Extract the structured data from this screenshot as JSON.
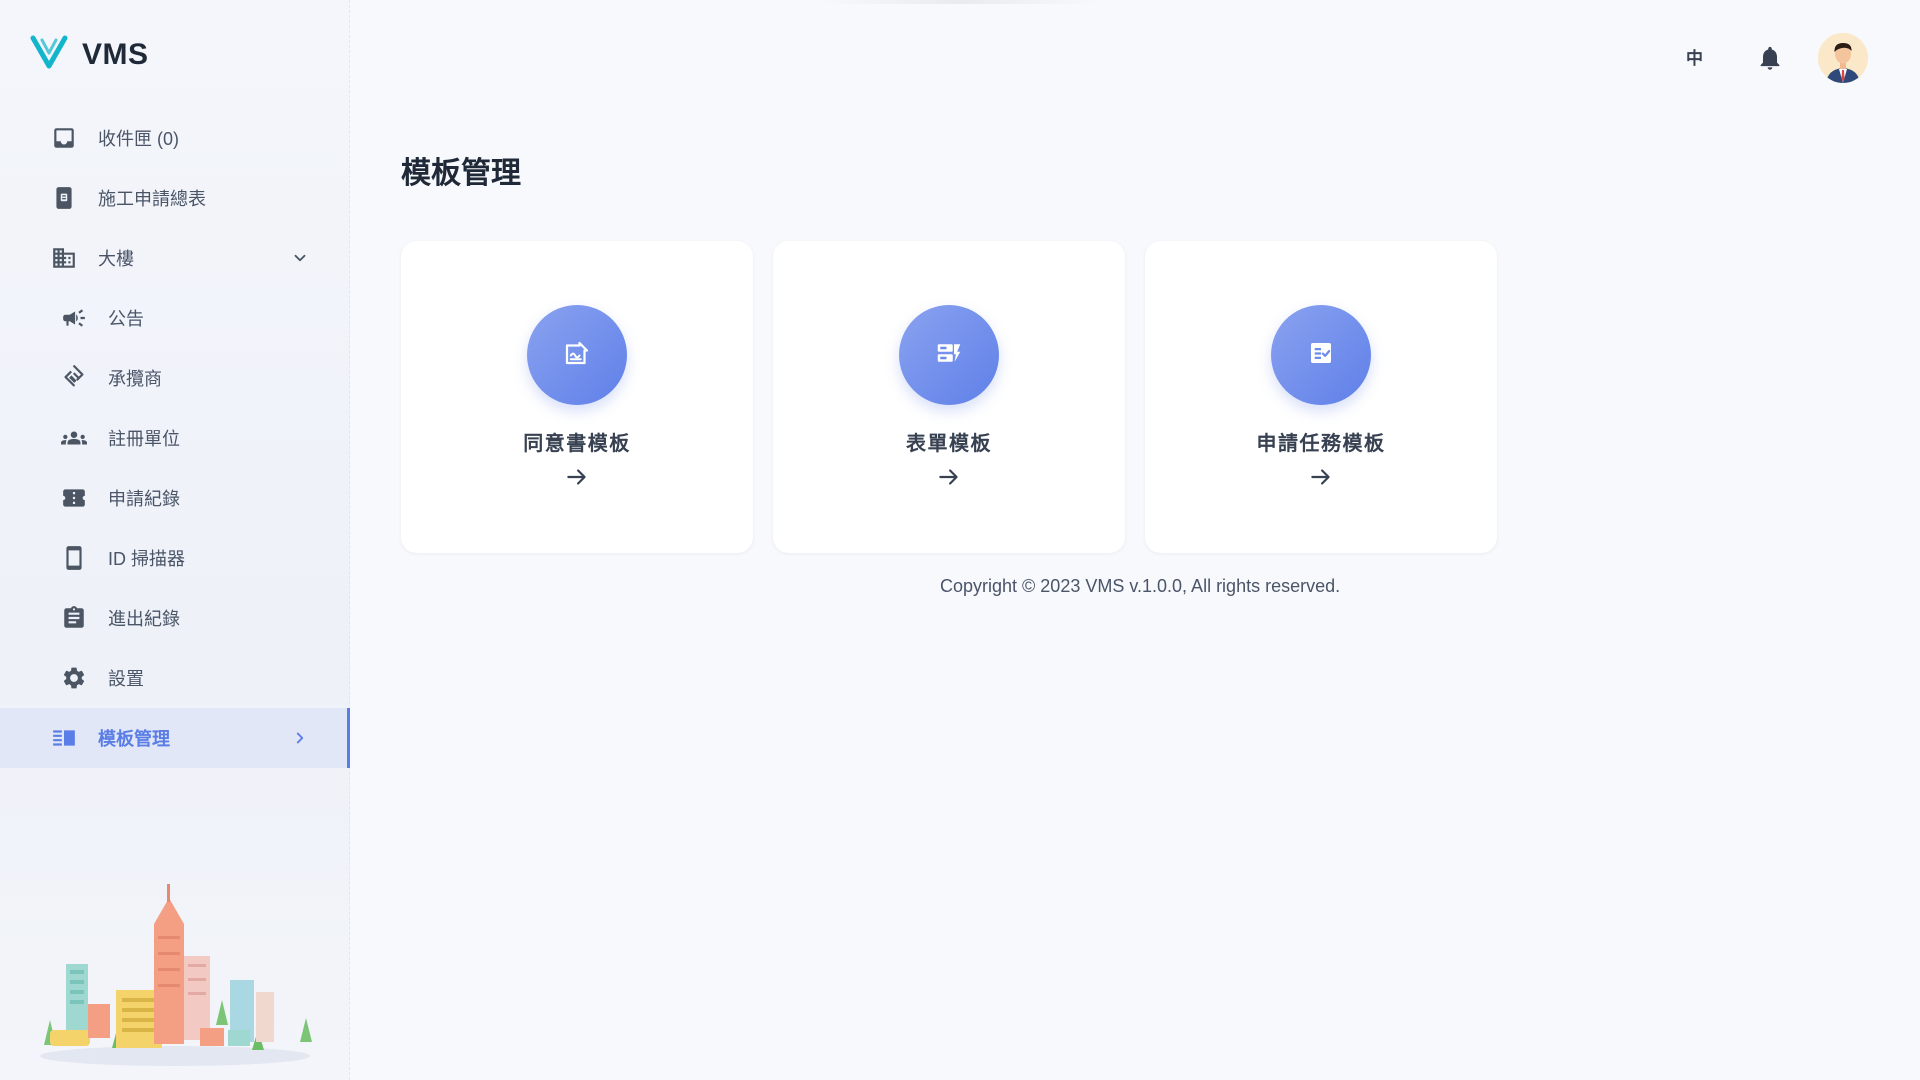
{
  "app": {
    "name": "VMS",
    "accent": "#5b7de6",
    "logo_color": "#12b5c9"
  },
  "topbar": {
    "language": "中"
  },
  "sidebar": {
    "items": [
      {
        "label": "收件匣 (0)",
        "icon": "inbox-icon"
      },
      {
        "label": "施工申請總表",
        "icon": "tablet-document-icon"
      },
      {
        "label": "大樓",
        "icon": "building-icon"
      },
      {
        "label": "公告",
        "icon": "megaphone-icon"
      },
      {
        "label": "承攬商",
        "icon": "handshake-icon"
      },
      {
        "label": "註冊單位",
        "icon": "group-icon"
      },
      {
        "label": "申請紀錄",
        "icon": "ticket-icon"
      },
      {
        "label": "ID 掃描器",
        "icon": "smartphone-icon"
      },
      {
        "label": "進出紀錄",
        "icon": "clipboard-icon"
      },
      {
        "label": "設置",
        "icon": "gear-icon"
      },
      {
        "label": "模板管理",
        "icon": "template-list-icon",
        "active": true
      }
    ]
  },
  "main": {
    "title": "模板管理",
    "cards": [
      {
        "title": "同意書模板",
        "icon": "signature-icon"
      },
      {
        "title": "表單模板",
        "icon": "form-icon"
      },
      {
        "title": "申請任務模板",
        "icon": "task-checklist-icon"
      }
    ]
  },
  "footer": {
    "copyright": "Copyright © 2023 VMS v.1.0.0, All rights reserved."
  }
}
